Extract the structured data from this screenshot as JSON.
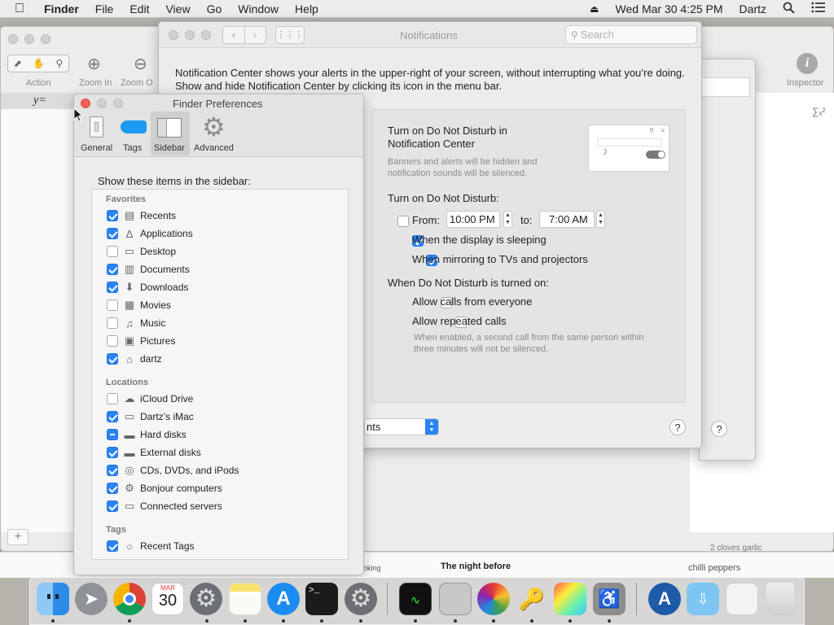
{
  "menubar": {
    "app_name": "Finder",
    "menus": [
      "File",
      "Edit",
      "View",
      "Go",
      "Window",
      "Help"
    ],
    "datetime": "Wed Mar 30  4:25 PM",
    "user": "Dartz"
  },
  "grapher": {
    "toolbar": {
      "action": "Action",
      "zoom_in": "Zoom In",
      "zoom_out": "Zoom O",
      "inspector": "Inspector"
    },
    "equation": "y=",
    "sigma": "∑ₓ²"
  },
  "background_texts": {
    "night_before": "The night before",
    "cloves": "2 cloves garlic",
    "chilli": "chilli peppers",
    "cooking": "oking"
  },
  "notifications": {
    "title": "Notifications",
    "search_placeholder": "Search",
    "description": "Notification Center shows your alerts in the upper-right of your screen, without interrupting what you’re doing. Show and hide Notification Center by clicking its icon in the menu bar.",
    "dnd_title_line1": "Turn on Do Not Disturb in",
    "dnd_title_line2": "Notification Center",
    "dnd_desc_line1": "Banners and alerts will be hidden and",
    "dnd_desc_line2": "notification sounds will be silenced.",
    "turn_on_label": "Turn on Do Not Disturb:",
    "from_label": "From:",
    "from_time": "10:00 PM",
    "to_label": "to:",
    "to_time": "7:00 AM",
    "display_sleeping": "When the display is sleeping",
    "mirroring": "When mirroring to TVs and projectors",
    "when_on_label": "When Do Not Disturb is turned on:",
    "allow_everyone": "Allow calls from everyone",
    "allow_repeated": "Allow repeated calls",
    "repeated_note_line1": "When enabled, a second call from the same person within",
    "repeated_note_line2": "three minutes will not be silenced.",
    "popup_value": "nts",
    "help": "?"
  },
  "finder_prefs": {
    "title": "Finder Preferences",
    "tabs": [
      "General",
      "Tags",
      "Sidebar",
      "Advanced"
    ],
    "heading": "Show these items in the sidebar:",
    "favorites_label": "Favorites",
    "favorites": [
      {
        "label": "Recents",
        "icon": "recents-icon",
        "checked": true
      },
      {
        "label": "Applications",
        "icon": "applications-icon",
        "checked": true
      },
      {
        "label": "Desktop",
        "icon": "desktop-icon",
        "checked": false
      },
      {
        "label": "Documents",
        "icon": "documents-icon",
        "checked": true
      },
      {
        "label": "Downloads",
        "icon": "downloads-icon",
        "checked": true
      },
      {
        "label": "Movies",
        "icon": "movies-icon",
        "checked": false
      },
      {
        "label": "Music",
        "icon": "music-icon",
        "checked": false
      },
      {
        "label": "Pictures",
        "icon": "pictures-icon",
        "checked": false
      },
      {
        "label": "dartz",
        "icon": "home-icon",
        "checked": true
      }
    ],
    "locations_label": "Locations",
    "locations": [
      {
        "label": "iCloud Drive",
        "icon": "icloud-icon",
        "checked": false
      },
      {
        "label": "Dartz’s iMac",
        "icon": "imac-icon",
        "checked": true
      },
      {
        "label": "Hard disks",
        "icon": "harddisk-icon",
        "state": "mixed"
      },
      {
        "label": "External disks",
        "icon": "external-disk-icon",
        "checked": true
      },
      {
        "label": "CDs, DVDs, and iPods",
        "icon": "cd-icon",
        "checked": true
      },
      {
        "label": "Bonjour computers",
        "icon": "bonjour-icon",
        "checked": true
      },
      {
        "label": "Connected servers",
        "icon": "server-icon",
        "checked": true
      }
    ],
    "tags_label": "Tags",
    "tags": [
      {
        "label": "Recent Tags",
        "icon": "tag-circle-icon",
        "checked": true
      }
    ]
  },
  "dock": {
    "calendar_month": "MAR",
    "calendar_day": "30",
    "colors": {
      "finder": "#2b8de8",
      "chrome": "#ffffff",
      "appstore": "#1d8cf0",
      "notes": "#f8e16c"
    }
  }
}
